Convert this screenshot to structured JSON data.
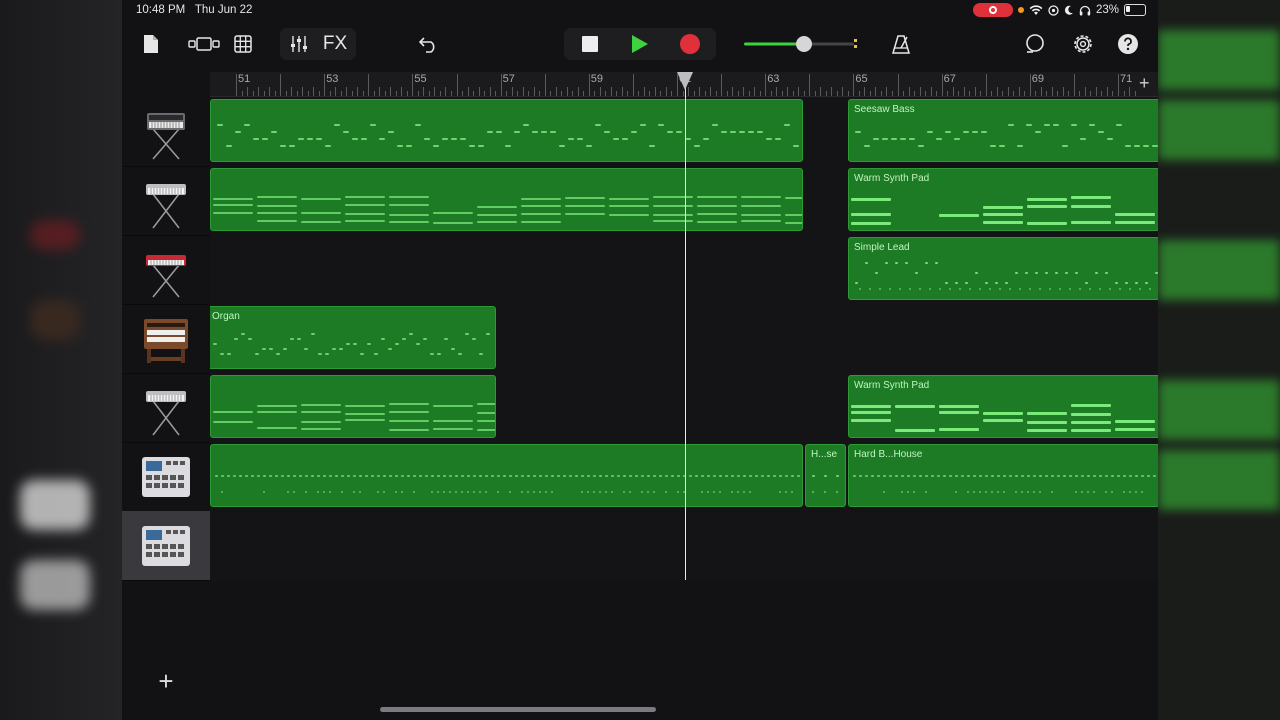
{
  "status_bar": {
    "time": "10:48 PM",
    "date": "Thu Jun 22",
    "battery": "23%"
  },
  "toolbar": {
    "fx_label": "FX"
  },
  "ruler": {
    "bar_numbers": [
      "51",
      "53",
      "55",
      "57",
      "59",
      "61",
      "63",
      "65",
      "67",
      "69",
      "71"
    ],
    "add_label": "+"
  },
  "tracks": [
    {
      "instrument": "synth-keyboard",
      "regions": [
        {
          "label": ""
        },
        {
          "label": "Seesaw Bass"
        }
      ]
    },
    {
      "instrument": "keyboard-stand",
      "regions": [
        {
          "label": ""
        },
        {
          "label": "Warm Synth Pad"
        }
      ]
    },
    {
      "instrument": "red-keyboard",
      "regions": [
        {
          "label": "Simple Lead"
        }
      ]
    },
    {
      "instrument": "organ",
      "regions": [
        {
          "label": "Organ"
        }
      ]
    },
    {
      "instrument": "keyboard-stand",
      "regions": [
        {
          "label": ""
        },
        {
          "label": "Warm Synth Pad"
        }
      ]
    },
    {
      "instrument": "drum-machine",
      "regions": [
        {
          "label": ""
        },
        {
          "label": "H...se"
        },
        {
          "label": "Hard B...House"
        }
      ]
    },
    {
      "instrument": "drum-machine",
      "regions": []
    }
  ],
  "add_track_label": "+",
  "colors": {
    "region_green": "#1d7a25",
    "accent_green": "#3fd23f",
    "record_red": "#e0303a"
  }
}
